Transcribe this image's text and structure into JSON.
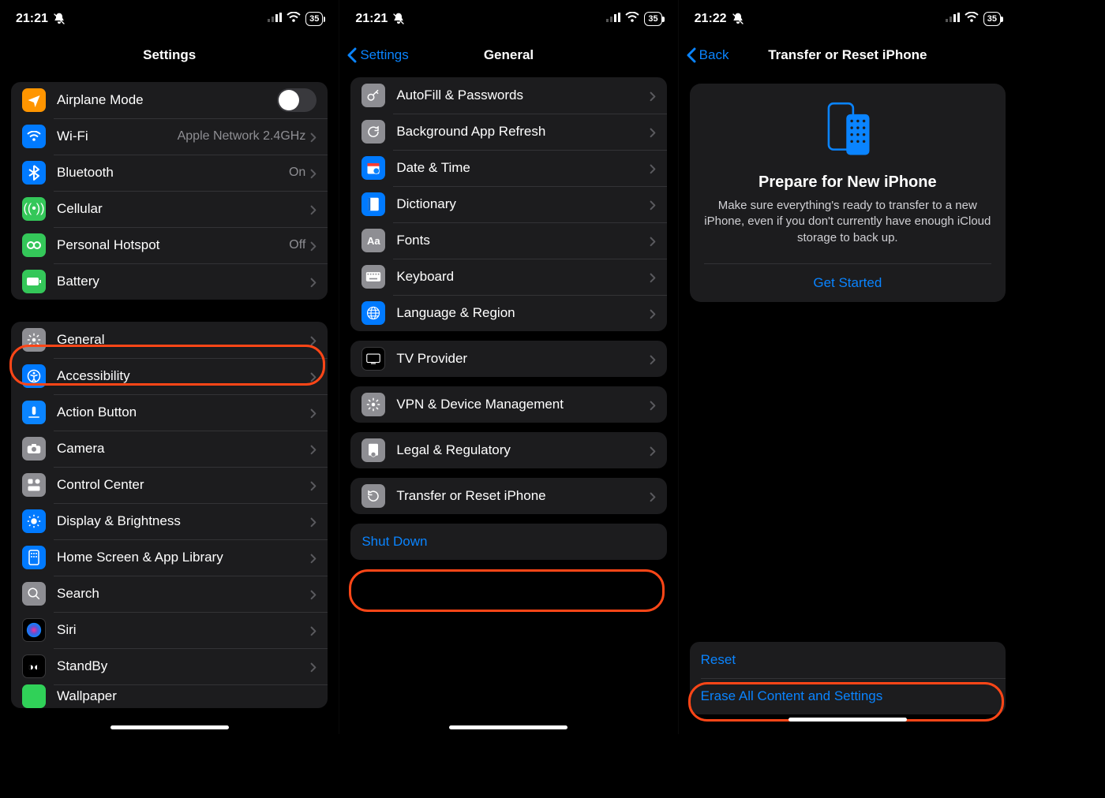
{
  "status": {
    "time_a": "21:21",
    "time_b": "21:21",
    "time_c": "21:22",
    "battery": "35"
  },
  "pane1": {
    "title": "Settings",
    "rows_top": [
      {
        "icon": "airplane",
        "label": "Airplane Mode",
        "value": "",
        "toggle": true
      },
      {
        "icon": "wifi",
        "label": "Wi-Fi",
        "value": "Apple Network 2.4GHz"
      },
      {
        "icon": "bluetooth",
        "label": "Bluetooth",
        "value": "On"
      },
      {
        "icon": "cellular",
        "label": "Cellular",
        "value": ""
      },
      {
        "icon": "hotspot",
        "label": "Personal Hotspot",
        "value": "Off"
      },
      {
        "icon": "battery",
        "label": "Battery",
        "value": ""
      }
    ],
    "rows_mid": [
      {
        "icon": "general",
        "label": "General"
      },
      {
        "icon": "accessibility",
        "label": "Accessibility"
      },
      {
        "icon": "action",
        "label": "Action Button"
      },
      {
        "icon": "camera",
        "label": "Camera"
      },
      {
        "icon": "control",
        "label": "Control Center"
      },
      {
        "icon": "display",
        "label": "Display & Brightness"
      },
      {
        "icon": "home",
        "label": "Home Screen & App Library"
      },
      {
        "icon": "search",
        "label": "Search"
      },
      {
        "icon": "siri",
        "label": "Siri"
      },
      {
        "icon": "standby",
        "label": "StandBy"
      },
      {
        "icon": "wallpaper",
        "label": "Wallpaper"
      }
    ]
  },
  "pane2": {
    "back": "Settings",
    "title": "General",
    "g1": [
      {
        "icon": "autofill",
        "label": "AutoFill & Passwords"
      },
      {
        "icon": "refresh",
        "label": "Background App Refresh"
      },
      {
        "icon": "datetime",
        "label": "Date & Time"
      },
      {
        "icon": "dictionary",
        "label": "Dictionary"
      },
      {
        "icon": "fonts",
        "label": "Fonts"
      },
      {
        "icon": "keyboard",
        "label": "Keyboard"
      },
      {
        "icon": "language",
        "label": "Language & Region"
      }
    ],
    "g2": [
      {
        "icon": "tv",
        "label": "TV Provider"
      }
    ],
    "g3": [
      {
        "icon": "vpn",
        "label": "VPN & Device Management"
      }
    ],
    "g4": [
      {
        "icon": "legal",
        "label": "Legal & Regulatory"
      }
    ],
    "g5": [
      {
        "icon": "reset",
        "label": "Transfer or Reset iPhone"
      }
    ],
    "shutdown": "Shut Down"
  },
  "pane3": {
    "back": "Back",
    "title": "Transfer or Reset iPhone",
    "card_title": "Prepare for New iPhone",
    "card_body": "Make sure everything's ready to transfer to a new iPhone, even if you don't currently have enough iCloud storage to back up.",
    "card_cta": "Get Started",
    "reset": "Reset",
    "erase": "Erase All Content and Settings"
  }
}
